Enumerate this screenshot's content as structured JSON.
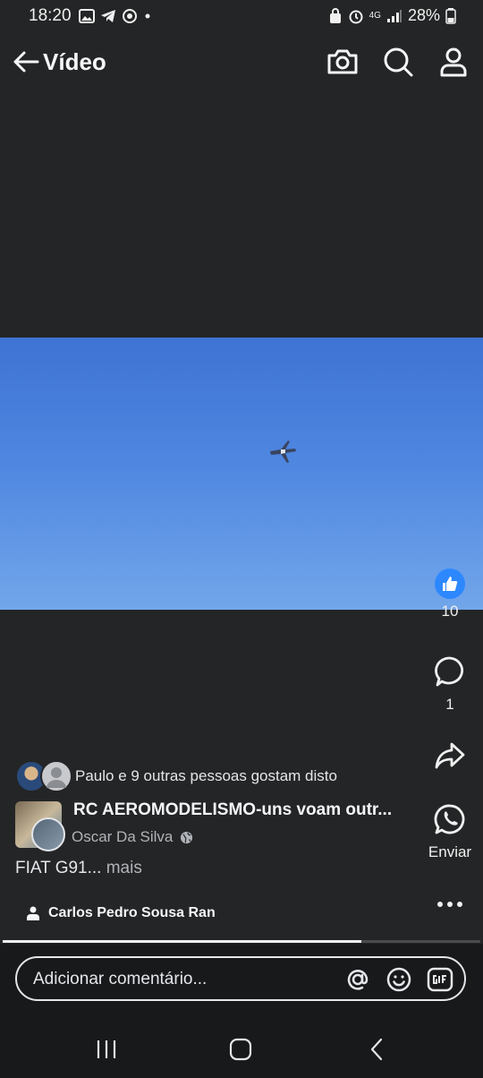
{
  "status": {
    "time": "18:20",
    "network": "4G",
    "battery": "28%"
  },
  "header": {
    "title": "Vídeo"
  },
  "actions": {
    "like_count": "10",
    "comment_count": "1",
    "whatsapp_label": "Enviar"
  },
  "post": {
    "likes_text": "Paulo e 9 outras pessoas gostam disto",
    "group_name": "RC AEROMODELISMO-uns voam outr...",
    "author": "Oscar Da Silva",
    "caption": "FIAT G91...",
    "caption_more": "mais",
    "credit": "Carlos Pedro Sousa Ran"
  },
  "video": {
    "progress": 0.75
  },
  "comment": {
    "placeholder": "Adicionar comentário..."
  },
  "colors": {
    "background": "#242526",
    "accent": "#2d88ff",
    "sky": "#4e86e0"
  }
}
